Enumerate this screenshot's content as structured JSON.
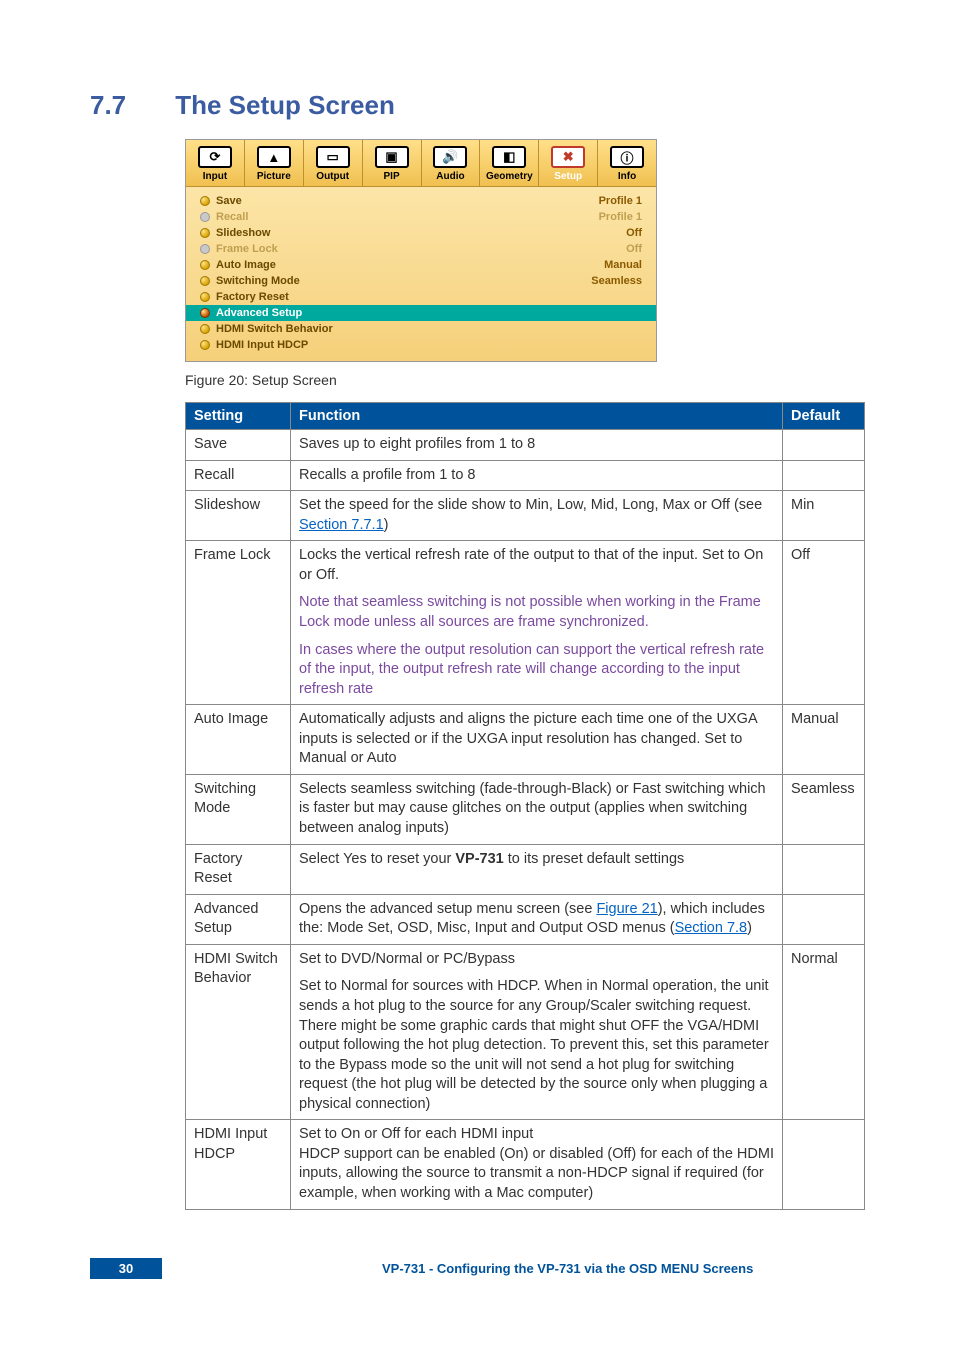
{
  "heading": {
    "num": "7.7",
    "title": "The Setup Screen"
  },
  "osd": {
    "tabs": [
      {
        "label": "Input",
        "glyph": "⟳"
      },
      {
        "label": "Picture",
        "glyph": "▲"
      },
      {
        "label": "Output",
        "glyph": "▭"
      },
      {
        "label": "PIP",
        "glyph": "▣"
      },
      {
        "label": "Audio",
        "glyph": "🔊"
      },
      {
        "label": "Geometry",
        "glyph": "◧"
      },
      {
        "label": "Setup",
        "glyph": "✖"
      },
      {
        "label": "Info",
        "glyph": "ⓘ"
      }
    ],
    "rows": [
      {
        "label": "Save",
        "value": "Profile 1",
        "dim": false
      },
      {
        "label": "Recall",
        "value": "Profile 1",
        "dim": true
      },
      {
        "label": "Slideshow",
        "value": "Off",
        "dim": false
      },
      {
        "label": "Frame Lock",
        "value": "Off",
        "dim": true
      },
      {
        "label": "Auto Image",
        "value": "Manual",
        "dim": false
      },
      {
        "label": "Switching Mode",
        "value": "Seamless",
        "dim": false
      },
      {
        "label": "Factory Reset",
        "value": "",
        "dim": false
      },
      {
        "label": "Advanced Setup",
        "value": "",
        "dim": false,
        "selected": true
      },
      {
        "label": "HDMI Switch Behavior",
        "value": "",
        "dim": false
      },
      {
        "label": "HDMI Input HDCP",
        "value": "",
        "dim": false
      }
    ]
  },
  "caption": "Figure 20: Setup Screen",
  "table": {
    "headers": {
      "setting": "Setting",
      "function": "Function",
      "default": "Default"
    },
    "rows": [
      {
        "setting": "Save",
        "default": "",
        "function": [
          {
            "t": "Saves up to eight profiles from 1 to 8"
          }
        ]
      },
      {
        "setting": "Recall",
        "default": "",
        "function": [
          {
            "t": "Recalls a profile from 1 to 8"
          }
        ]
      },
      {
        "setting": "Slideshow",
        "default": "Min",
        "function": [
          {
            "t": "Set the speed for the slide show to Min, Low, Mid, Long, Max or Off (see "
          },
          {
            "t": "Section 7.7.1",
            "link": true
          },
          {
            "t": ")"
          }
        ]
      },
      {
        "setting": "Frame Lock",
        "default": "Off",
        "function": [
          {
            "t": "Locks the vertical refresh rate of the output to that of the input. Set to On or Off."
          },
          {
            "br": true
          },
          {
            "t": "Note that seamless switching is not possible when working in the Frame Lock mode unless all sources are frame synchronized.",
            "emph": true
          },
          {
            "br": true
          },
          {
            "t": "In cases where the output resolution can support the vertical refresh rate of the input, the output refresh rate will change according to the input refresh rate",
            "emph": true
          }
        ]
      },
      {
        "setting": "Auto Image",
        "default": "Manual",
        "function": [
          {
            "t": "Automatically adjusts and aligns the picture each time one of the UXGA inputs is selected or if the UXGA input resolution has changed. Set to Manual or Auto"
          }
        ]
      },
      {
        "setting": "Switching Mode",
        "default": "Seamless",
        "function": [
          {
            "t": "Selects seamless switching (fade-through-Black) or Fast switching which is faster but may cause glitches on the output (applies when switching between analog inputs)"
          }
        ]
      },
      {
        "setting": "Factory Reset",
        "default": "",
        "function": [
          {
            "t": "Select Yes to reset your "
          },
          {
            "t": "VP-731",
            "bold": true
          },
          {
            "t": " to its preset default settings"
          }
        ]
      },
      {
        "setting": "Advanced Setup",
        "default": "",
        "function": [
          {
            "t": "Opens the advanced setup menu screen (see "
          },
          {
            "t": "Figure 21",
            "link": true
          },
          {
            "t": "), which includes the: Mode Set, OSD, Misc, Input and Output OSD menus ("
          },
          {
            "t": "Section 7.8",
            "link": true
          },
          {
            "t": ")"
          }
        ]
      },
      {
        "setting": "HDMI Switch Behavior",
        "default": "Normal",
        "function": [
          {
            "t": "Set to DVD/Normal or PC/Bypass"
          },
          {
            "br": true
          },
          {
            "t": "Set to Normal for sources with HDCP. When in Normal operation, the unit sends a hot plug to the source for any Group/Scaler switching request. There might be some graphic cards that might shut OFF the VGA/HDMI output following the hot plug detection. To prevent this, set this parameter to the Bypass mode so the unit will not send a hot plug for switching request (the hot plug will be detected by the source only when plugging a physical connection)"
          }
        ]
      },
      {
        "setting": "HDMI Input HDCP",
        "default": "",
        "function": [
          {
            "t": "Set to On or Off for each HDMI input"
          },
          {
            "nl": true
          },
          {
            "t": "HDCP support can be enabled (On) or disabled (Off) for each of the HDMI inputs, allowing the source to transmit a non-HDCP signal if required (for example, when working with a Mac computer)"
          }
        ]
      }
    ]
  },
  "footer": {
    "page": "30",
    "title": "VP-731 - Configuring the VP-731 via the OSD MENU Screens"
  }
}
